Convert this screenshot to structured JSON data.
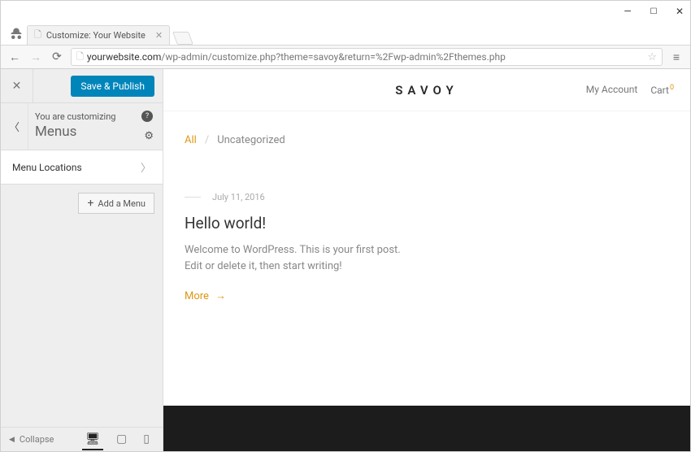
{
  "browser": {
    "tab_title": "Customize: Your Website",
    "url_scheme_icon": "🗎",
    "url_display": "yourwebsite.com/wp-admin/customize.php?theme=savoy&return=%2Fwp-admin%2Fthemes.php",
    "url_host": "yourwebsite.com",
    "url_path": "/wp-admin/customize.php?theme=savoy&return=%2Fwp-admin%2Fthemes.php"
  },
  "customizer": {
    "save_label": "Save & Publish",
    "you_are": "You are customizing",
    "panel_title": "Menus",
    "items": [
      {
        "label": "Menu Locations"
      }
    ],
    "add_menu_label": "Add a Menu",
    "collapse_label": "Collapse"
  },
  "preview": {
    "logo": "SAVOY",
    "my_account": "My Account",
    "cart_label": "Cart",
    "cart_count": "0",
    "breadcrumb_all": "All",
    "breadcrumb_sep": "/",
    "breadcrumb_cat": "Uncategorized",
    "post_date": "July 11, 2016",
    "post_title": "Hello world!",
    "post_excerpt": "Welcome to WordPress. This is your first post. Edit or delete it, then start writing!",
    "more_label": "More"
  }
}
